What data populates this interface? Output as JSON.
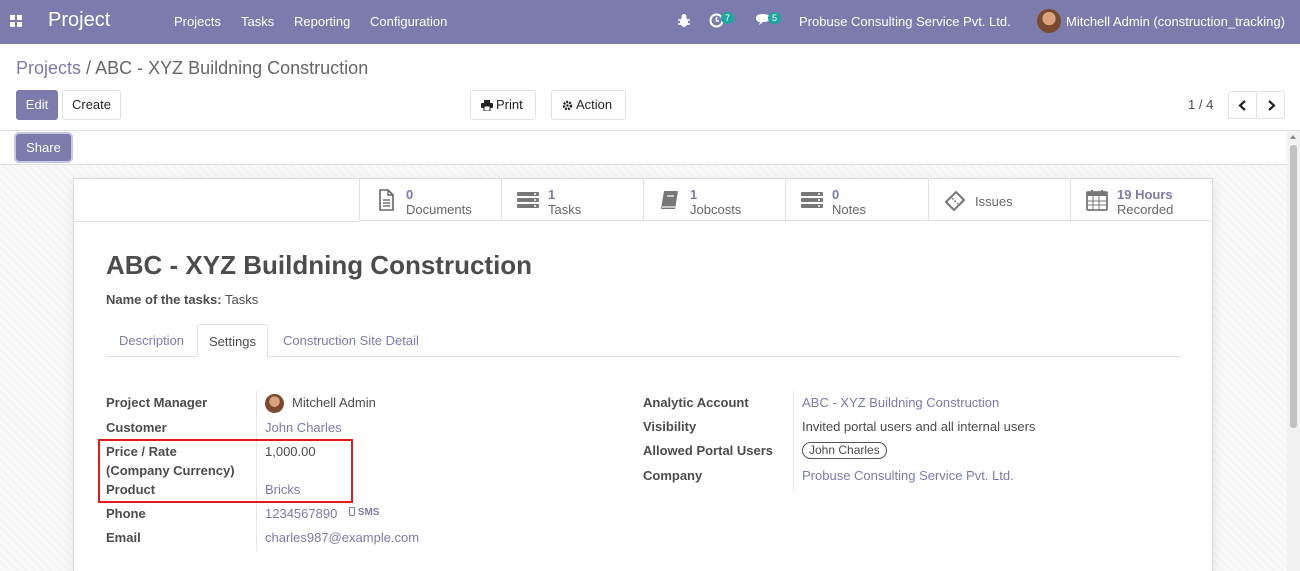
{
  "navbar": {
    "brand": "Project",
    "menu": [
      "Projects",
      "Tasks",
      "Reporting",
      "Configuration"
    ],
    "activity_count": "7",
    "message_count": "5",
    "company": "Probuse Consulting Service Pvt. Ltd.",
    "user": "Mitchell Admin (construction_tracking)"
  },
  "breadcrumb": {
    "parent": "Projects",
    "separator": "/",
    "current": "ABC - XYZ Buildning Construction"
  },
  "buttons": {
    "edit": "Edit",
    "create": "Create",
    "print": "Print",
    "action": "Action",
    "share": "Share"
  },
  "pager": {
    "value": "1 / 4"
  },
  "smart_buttons": [
    {
      "value": "0",
      "label": "Documents",
      "icon": "document-icon"
    },
    {
      "value": "1",
      "label": "Tasks",
      "icon": "tasks-icon"
    },
    {
      "value": "1",
      "label": "Jobcosts",
      "icon": "book-icon"
    },
    {
      "value": "0",
      "label": "Notes",
      "icon": "notes-icon"
    },
    {
      "value": "",
      "label": "Issues",
      "icon": "ticket-icon"
    },
    {
      "value": "19 Hours",
      "label": "Recorded",
      "icon": "calendar-icon"
    }
  ],
  "form": {
    "title": "ABC - XYZ Buildning Construction",
    "tasks_label": "Name of the tasks:",
    "tasks_value": "Tasks",
    "tabs": [
      "Description",
      "Settings",
      "Construction Site Detail"
    ],
    "left": {
      "project_manager_label": "Project Manager",
      "project_manager": "Mitchell Admin",
      "customer_label": "Customer",
      "customer": "John Charles",
      "price_label_1": "Price / Rate",
      "price_label_2": "(Company Currency)",
      "price": "1,000.00",
      "product_label": "Product",
      "product": "Bricks",
      "phone_label": "Phone",
      "phone": "1234567890",
      "sms": "SMS",
      "email_label": "Email",
      "email": "charles987@example.com"
    },
    "right": {
      "analytic_label": "Analytic Account",
      "analytic": "ABC - XYZ Buildning Construction",
      "visibility_label": "Visibility",
      "visibility": "Invited portal users and all internal users",
      "portal_label": "Allowed Portal Users",
      "portal_user": "John Charles",
      "company_label": "Company",
      "company": "Probuse Consulting Service Pvt. Ltd."
    }
  },
  "colors": {
    "primary": "#7c7bad",
    "highlight": "#e01b1b"
  }
}
